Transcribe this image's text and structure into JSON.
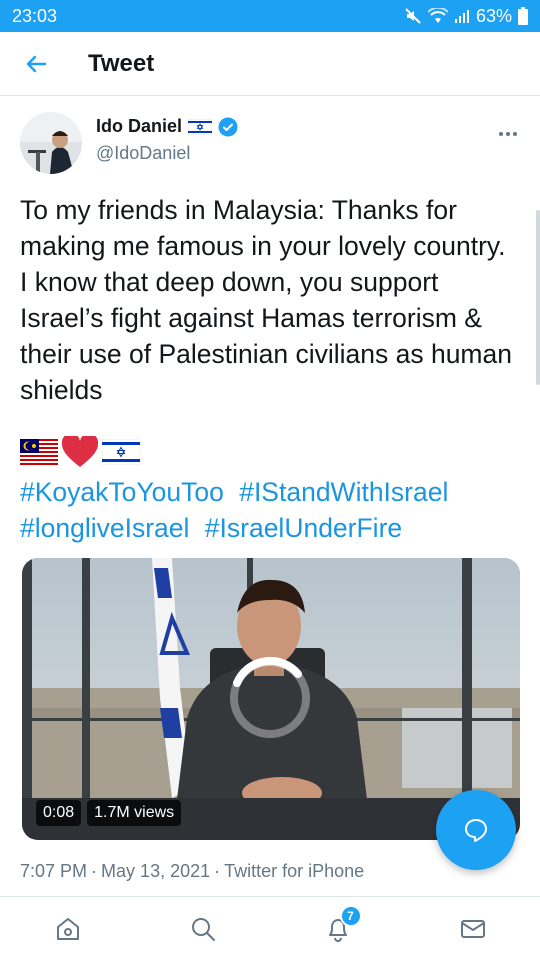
{
  "status_bar": {
    "time": "23:03",
    "battery": "63%"
  },
  "header": {
    "title": "Tweet",
    "back_icon": "arrow-left-icon"
  },
  "tweet": {
    "author_name": "Ido Daniel",
    "handle": "@IdoDaniel",
    "text": "To my friends in Malaysia: Thanks for making me famous in your lovely country. I know that deep down, you support Israel’s fight against Hamas terrorism & their use of Palestinian civilians as human shields",
    "emojis": [
      "malaysia-flag",
      "red-heart",
      "israel-flag"
    ],
    "hashtags": [
      "#KoyakToYouToo",
      "#IStandWithIsrael",
      "#longliveIsrael",
      "#IsraelUnderFire"
    ],
    "video": {
      "duration": "0:08",
      "views": "1.7M views"
    },
    "time": "7:07 PM",
    "date": "May 13, 2021",
    "source": "Twitter for iPhone"
  },
  "bottom_nav": {
    "notification_count": "7"
  },
  "colors": {
    "brand": "#1da1f2",
    "link": "#1b95e0",
    "secondary_text": "#657786"
  }
}
